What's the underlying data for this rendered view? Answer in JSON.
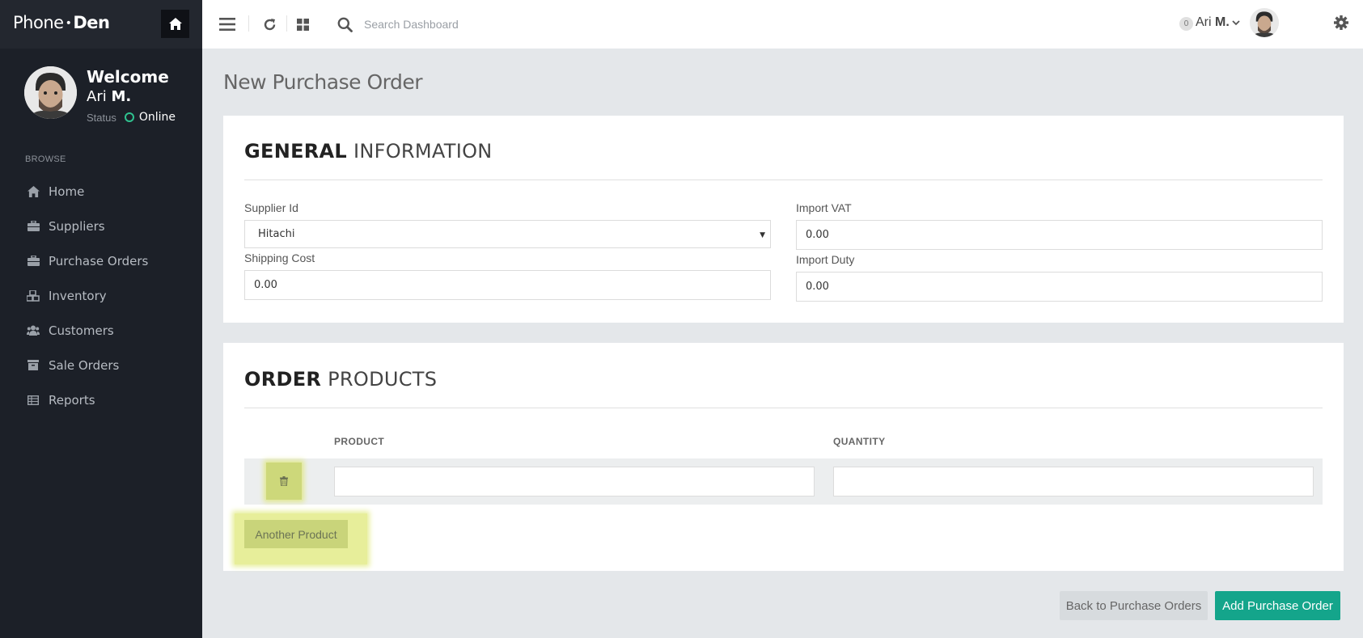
{
  "brand": {
    "part1": "Phone",
    "sep": "•",
    "part2": "Den"
  },
  "profile": {
    "welcome": "Welcome",
    "first_name": "Ari",
    "last_initial": "M.",
    "status_label": "Status",
    "status_value": "Online"
  },
  "sidebar": {
    "section": "BROWSE",
    "items": [
      {
        "label": "Home",
        "icon": "home-icon"
      },
      {
        "label": "Suppliers",
        "icon": "briefcase-icon"
      },
      {
        "label": "Purchase Orders",
        "icon": "briefcase-icon"
      },
      {
        "label": "Inventory",
        "icon": "cubes-icon"
      },
      {
        "label": "Customers",
        "icon": "users-icon"
      },
      {
        "label": "Sale Orders",
        "icon": "archive-icon"
      },
      {
        "label": "Reports",
        "icon": "table-icon"
      }
    ]
  },
  "topbar": {
    "search_placeholder": "Search Dashboard",
    "notification_count": "0",
    "user_first": "Ari",
    "user_last": "M."
  },
  "page": {
    "title": "New Purchase Order"
  },
  "general": {
    "title_strong": "GENERAL",
    "title_light": "INFORMATION",
    "supplier_label": "Supplier Id",
    "supplier_value": "Hitachi",
    "shipping_label": "Shipping Cost",
    "shipping_value": "0.00",
    "vat_label": "Import VAT",
    "vat_value": "0.00",
    "duty_label": "Import Duty",
    "duty_value": "0.00"
  },
  "order_products": {
    "title_strong": "ORDER",
    "title_light": "PRODUCTS",
    "col_product": "PRODUCT",
    "col_quantity": "QUANTITY",
    "another_label": "Another Product"
  },
  "actions": {
    "back_label": "Back to Purchase Orders",
    "add_label": "Add Purchase Order"
  },
  "colors": {
    "sidebar_bg": "#1c2028",
    "accent": "#14a58b",
    "online": "#2fc28f",
    "highlight": "#cdd87a"
  }
}
